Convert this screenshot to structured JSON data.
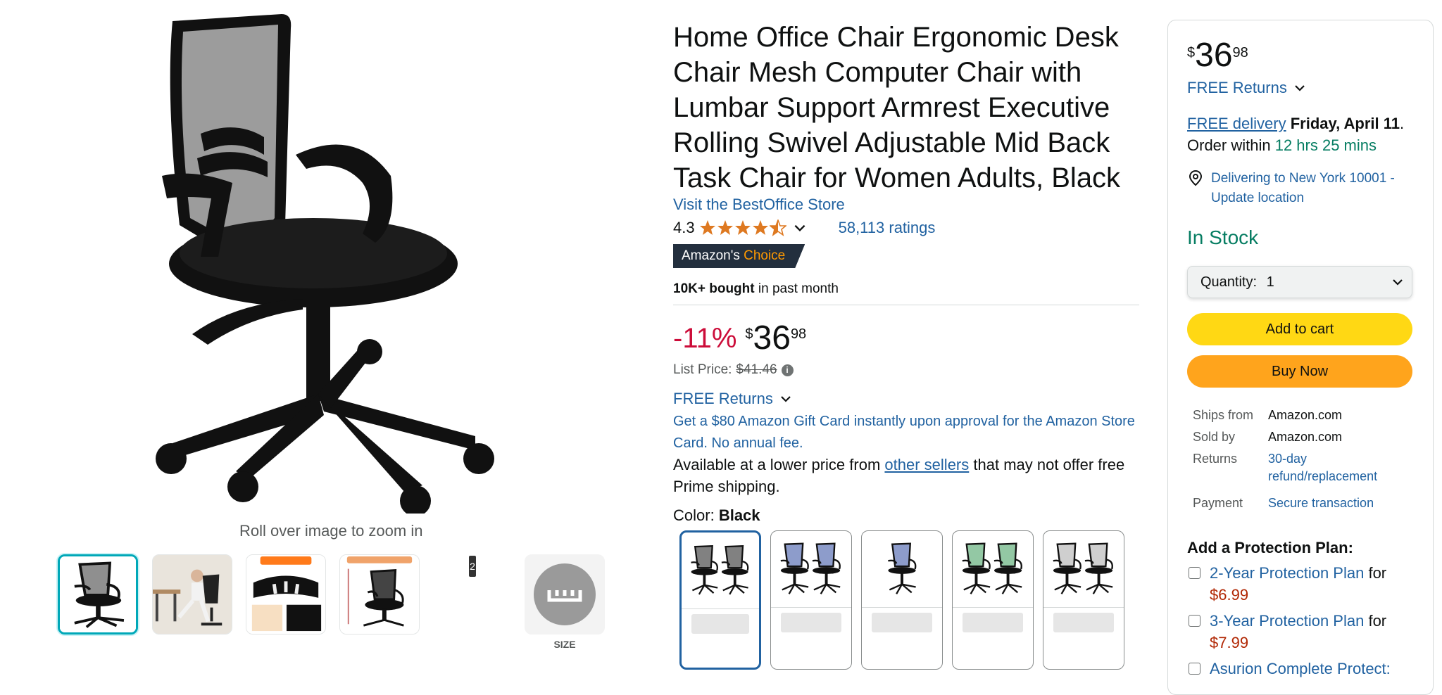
{
  "gallery": {
    "zoom_hint": "Roll over image to zoom in",
    "more_count": "2",
    "size_label": "SIZE"
  },
  "product": {
    "title": "Home Office Chair Ergonomic Desk Chair Mesh Computer Chair with Lumbar Support Armrest Executive Rolling Swivel Adjustable Mid Back Task Chair for Women Adults, Black",
    "store_link": "Visit the BestOffice Store",
    "rating_value": "4.3",
    "ratings_count": "58,113 ratings",
    "badge": {
      "prefix": "Amazon's",
      "accent": "Choice"
    },
    "bought_bold": "10K+ bought",
    "bought_rest": "in past month",
    "discount": "-11%",
    "price": {
      "symbol": "$",
      "whole": "36",
      "fraction": "98"
    },
    "list_price_label": "List Price:",
    "list_price": "$41.46",
    "free_returns": "FREE Returns",
    "gift_card": "Get a $80 Amazon Gift Card instantly upon approval for the Amazon Store Card. No annual fee.",
    "lower_price_pre": "Available at a lower price from",
    "lower_price_link": "other sellers",
    "lower_price_post": "that may not offer free Prime shipping.",
    "color_label": "Color:",
    "color_value": "Black",
    "swatch_colors": [
      "#1a1a1a",
      "#2f4aa0",
      "#2f4aa0",
      "#3a9a5a",
      "#a8a8a8"
    ]
  },
  "buybox": {
    "price": {
      "symbol": "$",
      "whole": "36",
      "fraction": "98"
    },
    "free_returns": "FREE Returns",
    "delivery_link": "FREE delivery",
    "delivery_date": "Friday, April 11",
    "delivery_period": ".",
    "order_within_label": "Order within",
    "order_within_time": "12 hrs 25 mins",
    "location": "Delivering to New York 10001 - Update location",
    "stock": "In Stock",
    "quantity_label": "Quantity:",
    "quantity_value": "1",
    "add_to_cart": "Add to cart",
    "buy_now": "Buy Now",
    "ships_from_label": "Ships from",
    "ships_from": "Amazon.com",
    "sold_by_label": "Sold by",
    "sold_by": "Amazon.com",
    "returns_label": "Returns",
    "returns": "30-day refund/replacement",
    "payment_label": "Payment",
    "payment": "Secure transaction",
    "protection_title": "Add a Protection Plan:",
    "plans": [
      {
        "name": "2-Year Protection Plan",
        "for": "for",
        "price": "$6.99"
      },
      {
        "name": "3-Year Protection Plan",
        "for": "for",
        "price": "$7.99"
      },
      {
        "name": "Asurion Complete Protect:"
      }
    ]
  },
  "colors": {
    "link": "#2162a1",
    "discount": "#cc0c39",
    "in_stock": "#067d62",
    "add_to_cart": "#ffd814",
    "buy_now": "#ffa41c",
    "star": "#de7921",
    "badge_bg": "#232f3e",
    "badge_accent": "#ff9900"
  }
}
